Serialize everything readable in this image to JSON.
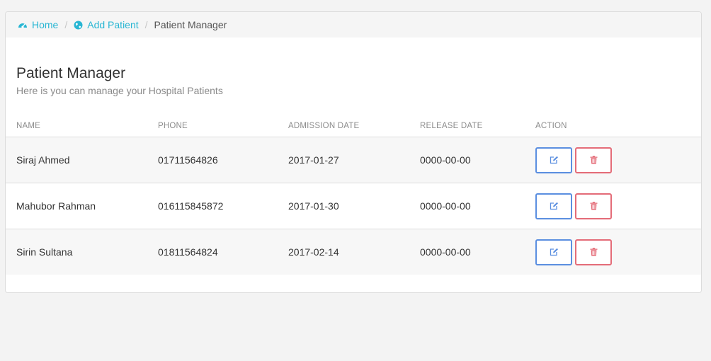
{
  "breadcrumb": {
    "items": [
      {
        "label": "Home",
        "icon": "dashboard-icon"
      },
      {
        "label": "Add Patient",
        "icon": "globe-icon"
      },
      {
        "label": "Patient Manager"
      }
    ],
    "separator": "/"
  },
  "header": {
    "title": "Patient Manager",
    "subtitle": "Here is you can manage your Hospital Patients"
  },
  "table": {
    "columns": [
      "NAME",
      "PHONE",
      "ADMISSION DATE",
      "RELEASE DATE",
      "ACTION"
    ],
    "rows": [
      {
        "name": "Siraj Ahmed",
        "phone": "01711564826",
        "admission": "2017-01-27",
        "release": "0000-00-00"
      },
      {
        "name": "Mahubor Rahman",
        "phone": "016115845872",
        "admission": "2017-01-30",
        "release": "0000-00-00"
      },
      {
        "name": "Sirin Sultana",
        "phone": "01811564824",
        "admission": "2017-02-14",
        "release": "0000-00-00"
      }
    ],
    "actions": {
      "edit_icon": "edit-icon",
      "delete_icon": "trash-icon"
    }
  },
  "colors": {
    "link": "#28b6d3",
    "edit": "#5b8fe0",
    "delete": "#e46c78"
  }
}
